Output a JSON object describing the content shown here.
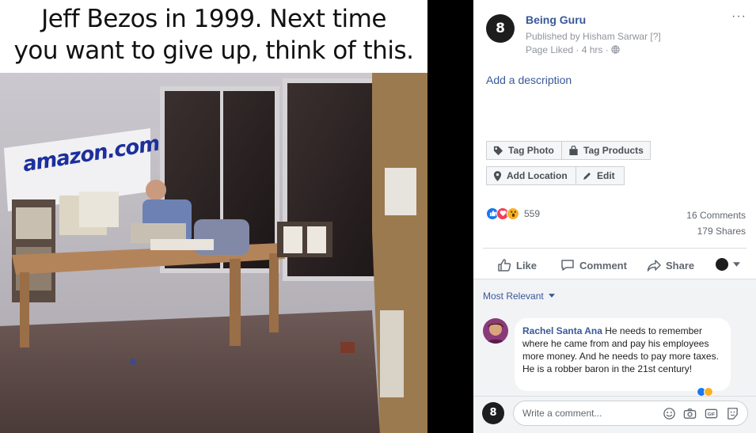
{
  "photo": {
    "caption_line1": "Jeff Bezos in 1999. Next time",
    "caption_line2": "you want to give up, think of this.",
    "sign_text": "amazon.com"
  },
  "post": {
    "page_name": "Being Guru",
    "avatar_text": "8",
    "published_by": "Published by Hisham Sarwar [?]",
    "page_liked": "Page Liked · 4 hrs · ",
    "more": "···",
    "add_description": "Add a description",
    "buttons": {
      "tag_photo": "Tag Photo",
      "tag_products": "Tag Products",
      "add_location": "Add Location",
      "edit": "Edit"
    },
    "reaction_count": "559",
    "comments_count": "16 Comments",
    "shares_count": "179 Shares",
    "actions": {
      "like": "Like",
      "comment": "Comment",
      "share": "Share"
    },
    "sort": "Most Relevant"
  },
  "comment": {
    "name": "Rachel Santa Ana",
    "text": " He needs to remember where he came from and pay his employees more money. And he needs to pay more taxes. He is a robber baron in the 21st century!"
  },
  "input": {
    "placeholder": "Write a comment..."
  },
  "colors": {
    "link": "#385898",
    "secondary_text": "#606770",
    "like_blue": "#1877f2",
    "love_red": "#f33e58",
    "wow_yellow": "#f7b125"
  },
  "icons": [
    "tag-icon",
    "shopping-bag-icon",
    "location-pin-icon",
    "pencil-icon",
    "like-icon",
    "love-icon",
    "wow-icon",
    "thumbs-up-icon",
    "comment-icon",
    "share-icon",
    "chevron-down-icon",
    "emoji-icon",
    "camera-icon",
    "gif-icon",
    "sticker-icon",
    "globe-icon"
  ]
}
